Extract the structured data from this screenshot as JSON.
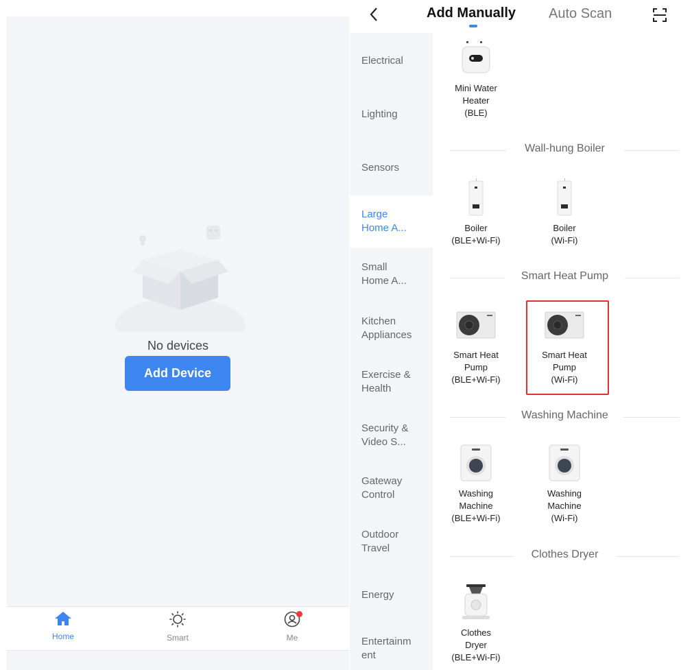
{
  "left_screen": {
    "empty_text": "No devices",
    "add_button": "Add Device",
    "tabs": [
      {
        "label": "Home",
        "icon": "home-icon",
        "active": true
      },
      {
        "label": "Smart",
        "icon": "sun-icon",
        "active": false
      },
      {
        "label": "Me",
        "icon": "user-icon",
        "active": false,
        "badge": true
      }
    ]
  },
  "right_screen": {
    "header": {
      "back_icon": "chevron-left-icon",
      "tab_manual": "Add Manually",
      "tab_scan": "Auto Scan",
      "scan_icon": "scan-icon"
    },
    "categories": [
      {
        "label": "Electrical",
        "active": false
      },
      {
        "label": "Lighting",
        "active": false
      },
      {
        "label": "Sensors",
        "active": false
      },
      {
        "label": "Large\nHome A...",
        "active": true
      },
      {
        "label": "Small\nHome A...",
        "active": false
      },
      {
        "label": "Kitchen\nAppliances",
        "active": false
      },
      {
        "label": "Exercise &\nHealth",
        "active": false
      },
      {
        "label": "Security &\nVideo S...",
        "active": false
      },
      {
        "label": "Gateway\nControl",
        "active": false
      },
      {
        "label": "Outdoor\nTravel",
        "active": false
      },
      {
        "label": "Energy",
        "active": false
      },
      {
        "label": "Entertainm\nent",
        "active": false
      }
    ],
    "devices": {
      "mini_water_heater": "Mini Water\nHeater\n(BLE)",
      "boiler_ble_wifi": "Boiler\n(BLE+Wi-Fi)",
      "boiler_wifi": "Boiler\n(Wi-Fi)",
      "heat_pump_ble_wifi": "Smart Heat\nPump\n(BLE+Wi-Fi)",
      "heat_pump_wifi": "Smart Heat\nPump\n(Wi-Fi)",
      "washer_ble_wifi": "Washing\nMachine\n(BLE+Wi-Fi)",
      "washer_wifi": "Washing\nMachine\n(Wi-Fi)",
      "dryer_ble_wifi": "Clothes\nDryer\n(BLE+Wi-Fi)"
    },
    "sections": {
      "boiler": "Wall-hung Boiler",
      "heat_pump": "Smart Heat Pump",
      "washing": "Washing Machine",
      "dryer": "Clothes Dryer"
    },
    "colors": {
      "accent": "#3d86f0",
      "highlight": "#e2312b",
      "badge": "#ef3a3a"
    }
  }
}
